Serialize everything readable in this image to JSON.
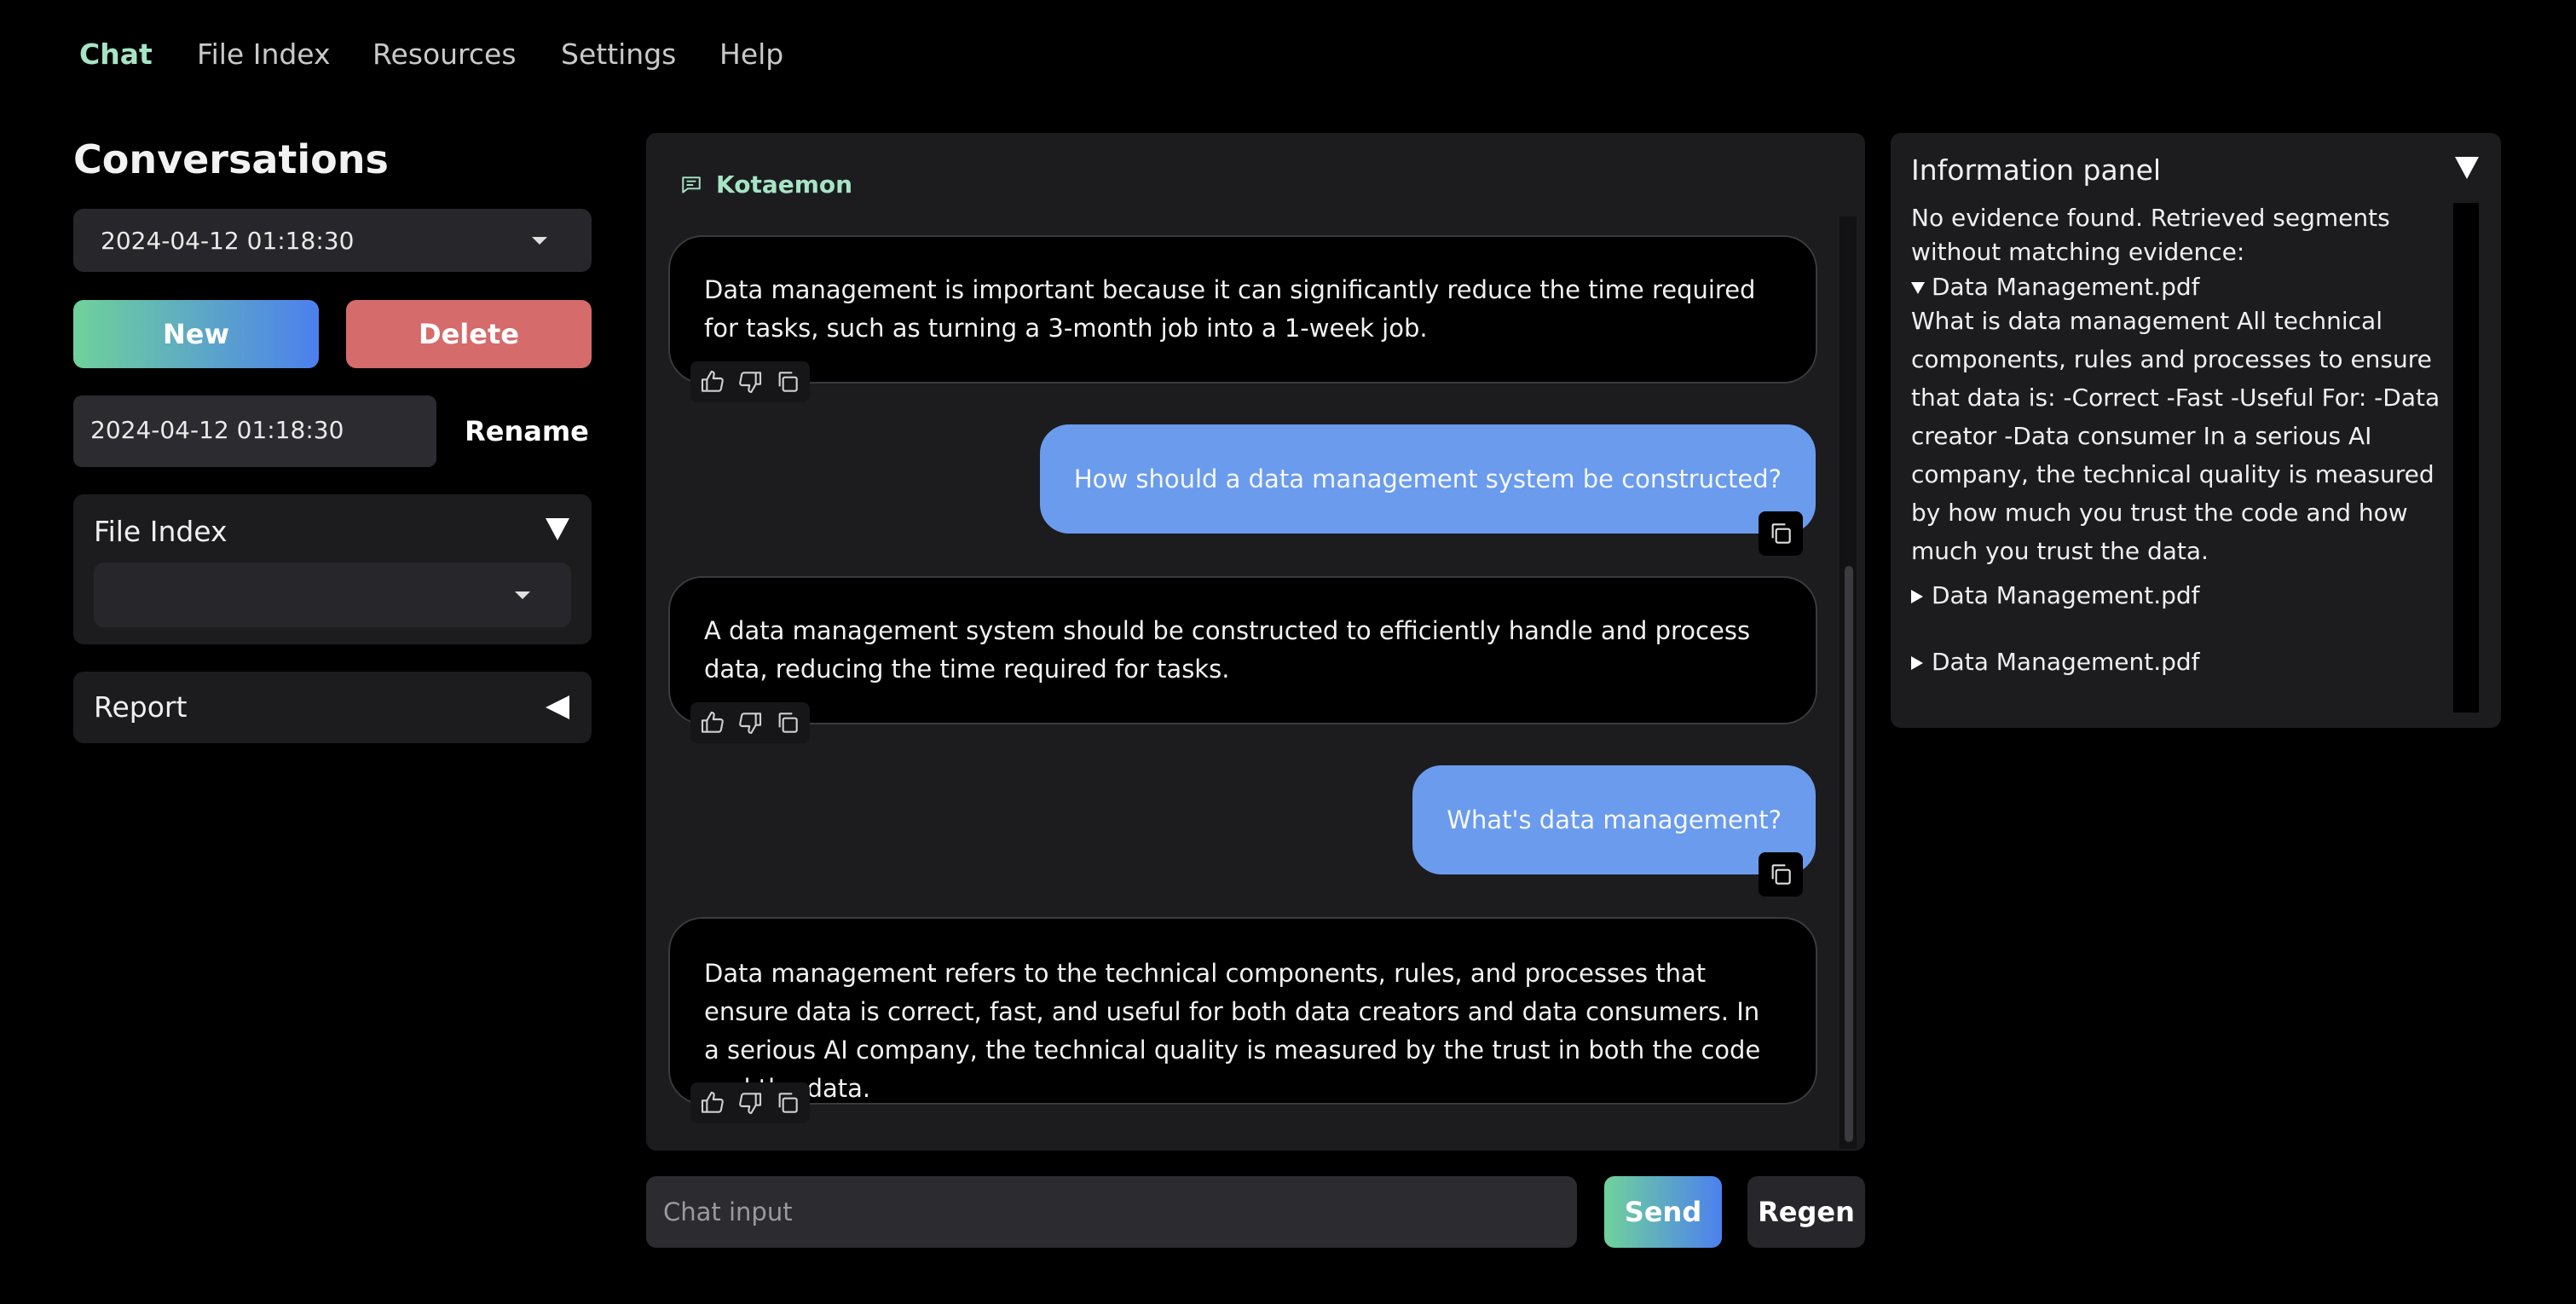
{
  "nav": {
    "tabs": [
      {
        "label": "Chat",
        "active": true
      },
      {
        "label": "File Index",
        "active": false
      },
      {
        "label": "Resources",
        "active": false
      },
      {
        "label": "Settings",
        "active": false
      },
      {
        "label": "Help",
        "active": false
      }
    ]
  },
  "sidebar": {
    "title": "Conversations",
    "conversation_select": "2024-04-12 01:18:30",
    "new_label": "New",
    "delete_label": "Delete",
    "rename_value": "2024-04-12 01:18:30",
    "rename_label": "Rename",
    "file_index_label": "File Index",
    "file_index_select": "",
    "report_label": "Report"
  },
  "chat": {
    "bot_name": "Kotaemon",
    "messages": [
      {
        "role": "bot",
        "text": "Data management is important because it can significantly reduce the time required for tasks, such as turning a 3-month job into a 1-week job."
      },
      {
        "role": "user",
        "text": "How should a data management system be constructed?"
      },
      {
        "role": "bot",
        "text": "A data management system should be constructed to efficiently handle and process data, reducing the time required for tasks."
      },
      {
        "role": "user",
        "text": "What's data management?"
      },
      {
        "role": "bot",
        "text": "Data management refers to the technical components, rules, and processes that ensure data is correct, fast, and useful for both data creators and data consumers. In a serious AI company, the technical quality is measured by the trust in both the code and the data."
      }
    ],
    "input_placeholder": "Chat input",
    "send_label": "Send",
    "regen_label": "Regen"
  },
  "info_panel": {
    "title": "Information panel",
    "intro": "No evidence found. Retrieved segments without matching evidence:",
    "expanded_file": "Data Management.pdf",
    "expanded_text": "What is data management All technical components, rules and processes to ensure that data is: -Correct -Fast -Useful For: -Data creator -Data consumer In a serious AI company, the technical quality is measured by how much you trust the code and how much you trust the data.",
    "collapsed_files": [
      "Data Management.pdf",
      "Data Management.pdf"
    ]
  },
  "colors": {
    "accent_green": "#a6e4c5",
    "user_bubble": "#6b9bec",
    "delete_red": "#d56b6b"
  }
}
